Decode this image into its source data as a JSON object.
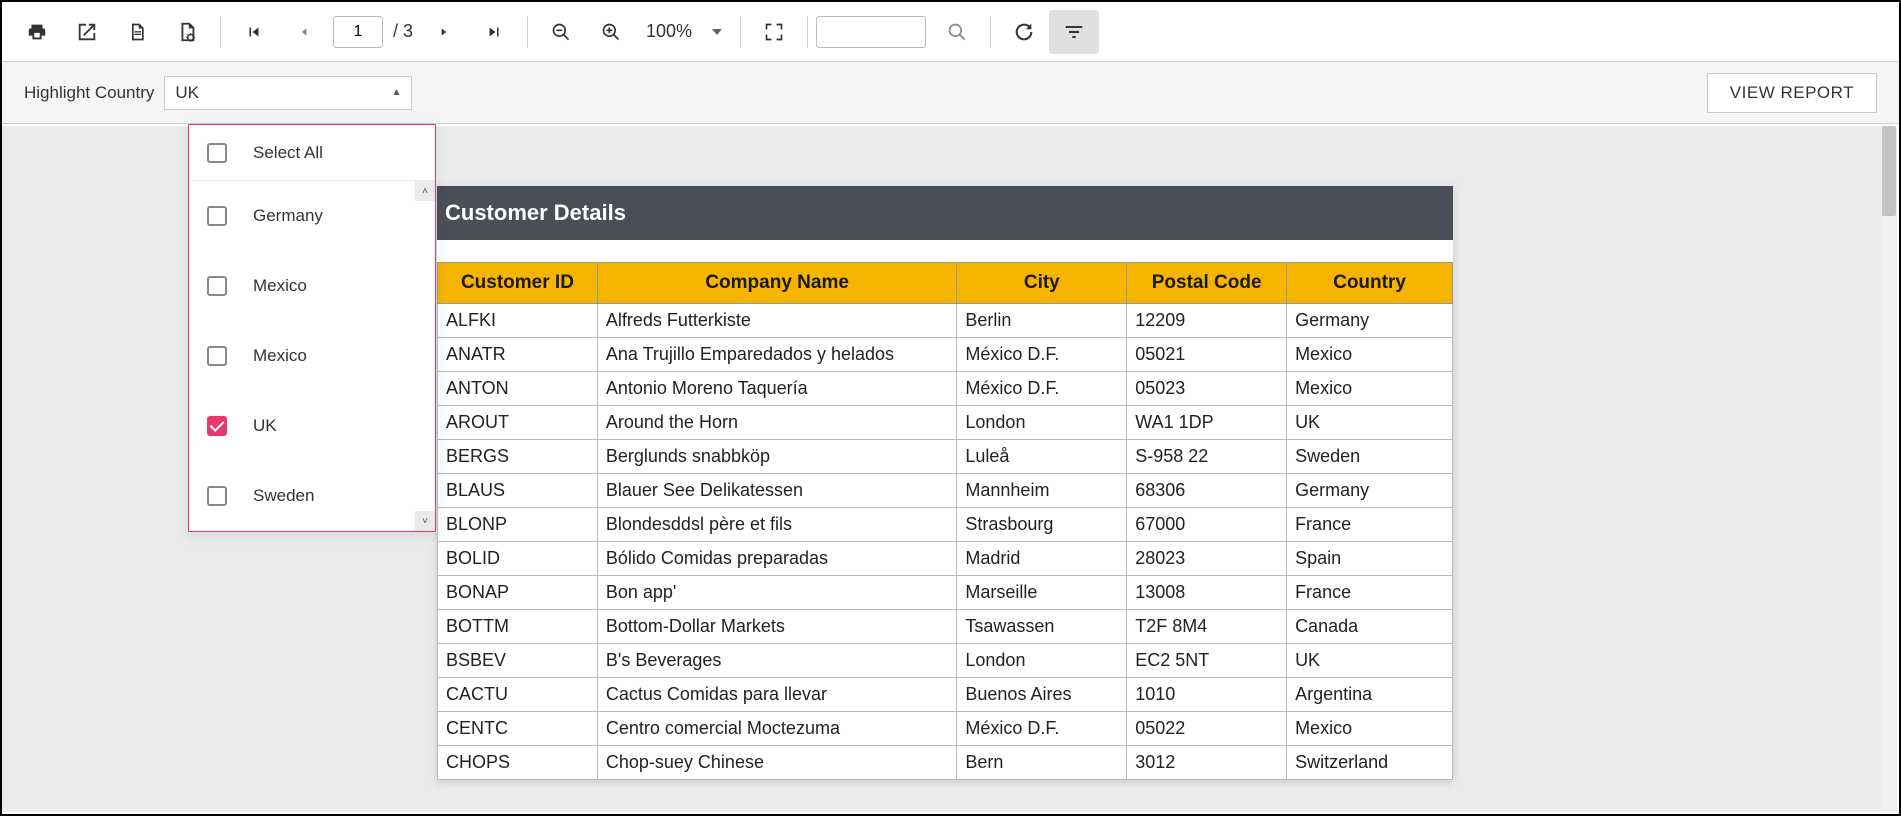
{
  "toolbar": {
    "page_current": "1",
    "page_total": "/ 3",
    "zoom": "100%",
    "icons": {
      "print": "print-icon",
      "export": "export-icon",
      "page_setup": "page-setup-icon",
      "page_settings": "page-settings-icon",
      "first": "first-page-icon",
      "prev": "prev-page-icon",
      "next": "next-page-icon",
      "last": "last-page-icon",
      "zoom_out": "zoom-out-icon",
      "zoom_in": "zoom-in-icon",
      "fullscreen": "fullscreen-icon",
      "search": "search-icon",
      "refresh": "refresh-icon",
      "filter": "filter-icon"
    }
  },
  "params": {
    "label": "Highlight Country",
    "selected": "UK",
    "view_report_label": "VIEW REPORT",
    "select_all_label": "Select All",
    "options": [
      {
        "label": "Germany",
        "checked": false
      },
      {
        "label": "Mexico",
        "checked": false
      },
      {
        "label": "Mexico",
        "checked": false
      },
      {
        "label": "UK",
        "checked": true
      },
      {
        "label": "Sweden",
        "checked": false
      }
    ]
  },
  "report": {
    "title": "Customer Details",
    "columns": [
      "Customer ID",
      "Company Name",
      "City",
      "Postal Code",
      "Country"
    ],
    "rows": [
      [
        "ALFKI",
        "Alfreds Futterkiste",
        "Berlin",
        "12209",
        "Germany"
      ],
      [
        "ANATR",
        "Ana Trujillo Emparedados y helados",
        "México D.F.",
        "05021",
        "Mexico"
      ],
      [
        "ANTON",
        "Antonio Moreno Taquería",
        "México D.F.",
        "05023",
        "Mexico"
      ],
      [
        "AROUT",
        "Around the Horn",
        "London",
        "WA1 1DP",
        "UK"
      ],
      [
        "BERGS",
        "Berglunds snabbköp",
        "Luleå",
        "S-958 22",
        "Sweden"
      ],
      [
        "BLAUS",
        "Blauer See Delikatessen",
        "Mannheim",
        "68306",
        "Germany"
      ],
      [
        "BLONP",
        "Blondesddsl père et fils",
        "Strasbourg",
        "67000",
        "France"
      ],
      [
        "BOLID",
        "Bólido Comidas preparadas",
        "Madrid",
        "28023",
        "Spain"
      ],
      [
        "BONAP",
        "Bon app'",
        "Marseille",
        "13008",
        "France"
      ],
      [
        "BOTTM",
        "Bottom-Dollar Markets",
        "Tsawassen",
        "T2F 8M4",
        "Canada"
      ],
      [
        "BSBEV",
        "B's Beverages",
        "London",
        "EC2 5NT",
        "UK"
      ],
      [
        "CACTU",
        "Cactus Comidas para llevar",
        "Buenos Aires",
        "1010",
        "Argentina"
      ],
      [
        "CENTC",
        "Centro comercial Moctezuma",
        "México D.F.",
        "05022",
        "Mexico"
      ],
      [
        "CHOPS",
        "Chop-suey Chinese",
        "Bern",
        "3012",
        "Switzerland"
      ]
    ]
  }
}
